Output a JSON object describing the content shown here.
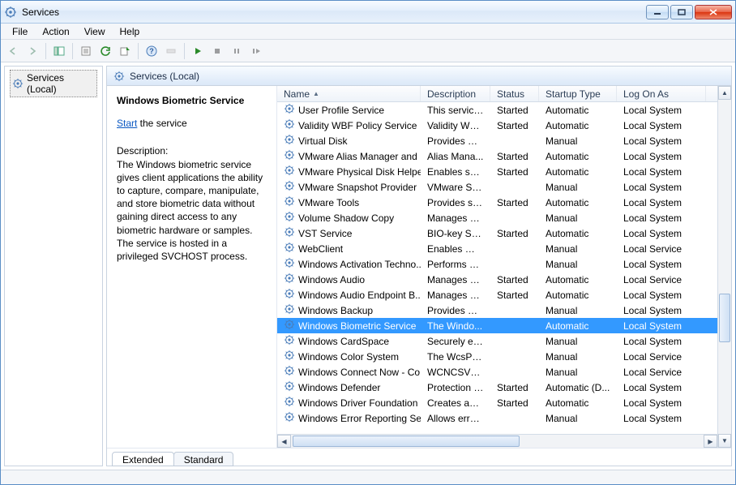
{
  "window": {
    "title": "Services"
  },
  "menu": {
    "file": "File",
    "action": "Action",
    "view": "View",
    "help": "Help"
  },
  "tree": {
    "root": "Services (Local)"
  },
  "pane": {
    "header": "Services (Local)"
  },
  "detail": {
    "svcname": "Windows Biometric Service",
    "startlink": "Start",
    "starttail": " the service",
    "desclabel": "Description:",
    "desc": "The Windows biometric service gives client applications the ability to capture, compare, manipulate, and store biometric data without gaining direct access to any biometric hardware or samples. The service is hosted in a privileged SVCHOST process."
  },
  "columns": {
    "name": "Name",
    "description": "Description",
    "status": "Status",
    "startup": "Startup Type",
    "logon": "Log On As"
  },
  "widths": {
    "name": 177,
    "description": 86,
    "status": 60,
    "startup": 96,
    "logon": 110
  },
  "tabs": {
    "extended": "Extended",
    "standard": "Standard"
  },
  "services": [
    {
      "name": "User Profile Service",
      "desc": "This service ...",
      "status": "Started",
      "startup": "Automatic",
      "logon": "Local System"
    },
    {
      "name": "Validity WBF Policy Service",
      "desc": "Validity WB...",
      "status": "Started",
      "startup": "Automatic",
      "logon": "Local System"
    },
    {
      "name": "Virtual Disk",
      "desc": "Provides m...",
      "status": "",
      "startup": "Manual",
      "logon": "Local System"
    },
    {
      "name": "VMware Alias Manager and ...",
      "desc": "Alias Mana...",
      "status": "Started",
      "startup": "Automatic",
      "logon": "Local System"
    },
    {
      "name": "VMware Physical Disk Helpe...",
      "desc": "Enables sup...",
      "status": "Started",
      "startup": "Automatic",
      "logon": "Local System"
    },
    {
      "name": "VMware Snapshot Provider",
      "desc": "VMware Sn...",
      "status": "",
      "startup": "Manual",
      "logon": "Local System"
    },
    {
      "name": "VMware Tools",
      "desc": "Provides su...",
      "status": "Started",
      "startup": "Automatic",
      "logon": "Local System"
    },
    {
      "name": "Volume Shadow Copy",
      "desc": "Manages an...",
      "status": "",
      "startup": "Manual",
      "logon": "Local System"
    },
    {
      "name": "VST Service",
      "desc": "BIO-key Ser...",
      "status": "Started",
      "startup": "Automatic",
      "logon": "Local System"
    },
    {
      "name": "WebClient",
      "desc": "Enables Win...",
      "status": "",
      "startup": "Manual",
      "logon": "Local Service"
    },
    {
      "name": "Windows Activation Techno...",
      "desc": "Performs W...",
      "status": "",
      "startup": "Manual",
      "logon": "Local System"
    },
    {
      "name": "Windows Audio",
      "desc": "Manages au...",
      "status": "Started",
      "startup": "Automatic",
      "logon": "Local Service"
    },
    {
      "name": "Windows Audio Endpoint B...",
      "desc": "Manages au...",
      "status": "Started",
      "startup": "Automatic",
      "logon": "Local System"
    },
    {
      "name": "Windows Backup",
      "desc": "Provides Wi...",
      "status": "",
      "startup": "Manual",
      "logon": "Local System"
    },
    {
      "name": "Windows Biometric Service",
      "desc": "The Windo...",
      "status": "",
      "startup": "Automatic",
      "logon": "Local System",
      "selected": true
    },
    {
      "name": "Windows CardSpace",
      "desc": "Securely en...",
      "status": "",
      "startup": "Manual",
      "logon": "Local System"
    },
    {
      "name": "Windows Color System",
      "desc": "The WcsPlu...",
      "status": "",
      "startup": "Manual",
      "logon": "Local Service"
    },
    {
      "name": "Windows Connect Now - Co...",
      "desc": "WCNCSVC ...",
      "status": "",
      "startup": "Manual",
      "logon": "Local Service"
    },
    {
      "name": "Windows Defender",
      "desc": "Protection a...",
      "status": "Started",
      "startup": "Automatic (D...",
      "logon": "Local System"
    },
    {
      "name": "Windows Driver Foundation ...",
      "desc": "Creates and ...",
      "status": "Started",
      "startup": "Automatic",
      "logon": "Local System"
    },
    {
      "name": "Windows Error Reporting Ser...",
      "desc": "Allows error...",
      "status": "",
      "startup": "Manual",
      "logon": "Local System"
    }
  ]
}
